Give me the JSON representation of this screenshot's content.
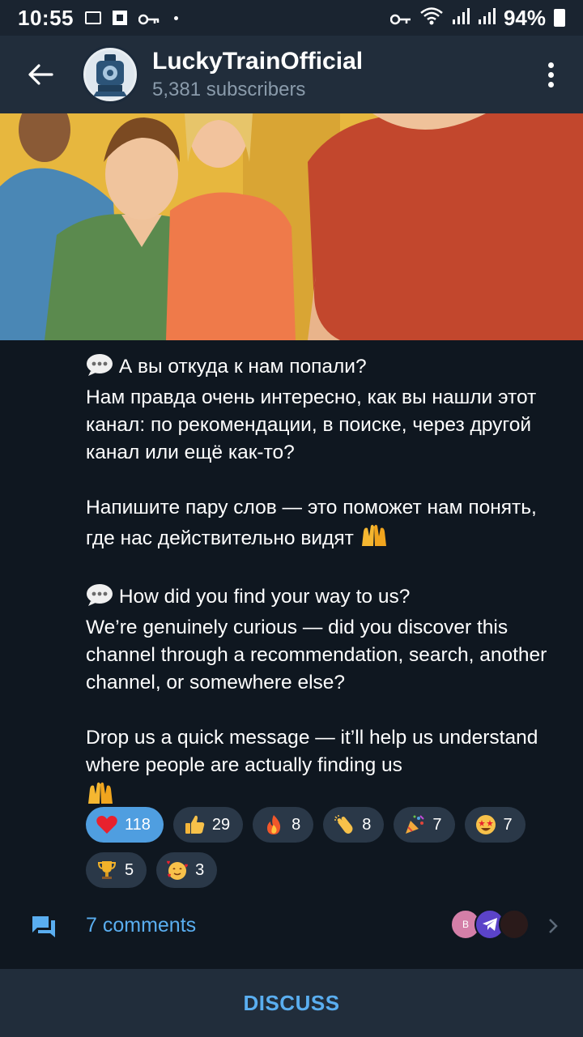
{
  "status_bar": {
    "time": "10:55",
    "battery": "94%"
  },
  "header": {
    "channel_name": "LuckyTrainOfficial",
    "subscribers": "5,381 subscribers"
  },
  "post": {
    "ru_line1": "А вы откуда к нам попали?",
    "ru_line2": "Нам правда очень интересно, как вы нашли этот канал: по рекомендации, в поиске, через другой канал или ещё как-то?",
    "ru_line3": "Напишите пару слов — это поможет нам понять, где нас действительно видят",
    "en_line1": "How did you find your way to us?",
    "en_line2": "We’re genuinely curious — did you discover this channel through a recommendation, search, another channel, or somewhere else?",
    "en_line3": "Drop us a quick message — it’ll help us understand where people are actually finding us"
  },
  "reactions": [
    {
      "emoji": "heart",
      "count": "118",
      "active": true
    },
    {
      "emoji": "thumbs-up",
      "count": "29"
    },
    {
      "emoji": "fire",
      "count": "8"
    },
    {
      "emoji": "clap",
      "count": "8"
    },
    {
      "emoji": "party-popper",
      "count": "7"
    },
    {
      "emoji": "star-struck",
      "count": "7"
    },
    {
      "emoji": "trophy",
      "count": "5"
    },
    {
      "emoji": "smiling-face-hearts",
      "count": "3"
    }
  ],
  "comments": {
    "label": "7 comments",
    "avatar1_initial": "B"
  },
  "discuss_label": "DISCUSS",
  "colors": {
    "background": "#0f1720",
    "header": "#212d3b",
    "accent": "#5aaef0",
    "reaction_active": "#4f9ee0",
    "reaction_bg": "#2a3848"
  }
}
